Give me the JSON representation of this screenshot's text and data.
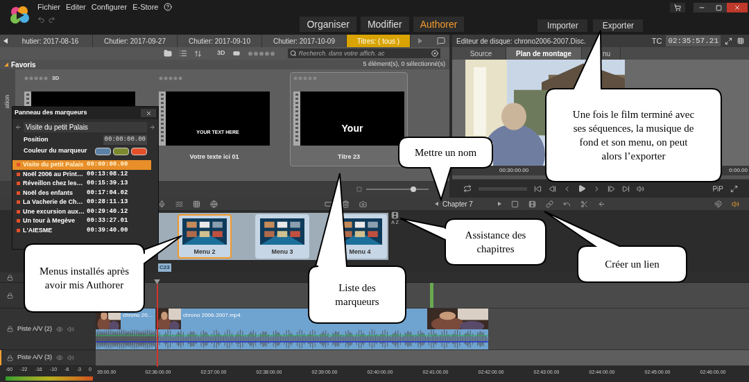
{
  "menu_bar": {
    "items": [
      "Fichier",
      "Editer",
      "Configurer",
      "E-Store"
    ]
  },
  "modes": [
    {
      "label": "Organiser",
      "selected": false
    },
    {
      "label": "Modifier",
      "selected": false
    },
    {
      "label": "Authorer",
      "selected": true
    }
  ],
  "actions": [
    "Importer",
    "Exporter"
  ],
  "library": {
    "bins": [
      {
        "label": "hutier: 2017-08-16",
        "selected": false
      },
      {
        "label": "Chutier: 2017-09-27",
        "selected": false
      },
      {
        "label": "Chutier: 2017-09-10",
        "selected": false
      },
      {
        "label": "Chutier: 2017-10-09",
        "selected": false
      },
      {
        "label": "Titres: ( tous )",
        "selected": true
      }
    ],
    "filter_3d": "3D",
    "search": {
      "placeholder": "Recherch. dans votre affich. ac"
    },
    "section": "Favoris",
    "count": "5 élément(s), 0 sélectionné(s)",
    "side_tab": "ation",
    "items": [
      {
        "tag": "3D",
        "selected": false
      },
      {
        "preview_text": "YOUR TEXT HERE",
        "caption": "Votre texte ici 01",
        "selected": false
      },
      {
        "preview_text": "Your",
        "caption": "Titre 23",
        "selected": true
      }
    ],
    "zoom": {
      "level": 0.75
    }
  },
  "marker_panel": {
    "title": "Panneau des marqueurs",
    "name": "Visite du petit Palais",
    "position_label": "Position",
    "position": "00:00:00.00",
    "color_label": "Couleur du marqueur",
    "colors": [
      {
        "color": "#5b82a6"
      },
      {
        "color": "#7d8a2e"
      },
      {
        "color": "#e4502a"
      }
    ],
    "markers": [
      {
        "name": "Visite du petit Palais",
        "time": "00:00:00.00",
        "selected": true
      },
      {
        "name": "Noël 2006 au Print…",
        "time": "00:13:08.12",
        "selected": false
      },
      {
        "name": "Réveillon chez les…",
        "time": "00:15:39.13",
        "selected": false
      },
      {
        "name": "Noël des enfants",
        "time": "00:17:04.02",
        "selected": false
      },
      {
        "name": "La Vacherie de Ch…",
        "time": "00:28:11.13",
        "selected": false
      },
      {
        "name": "Une excursion aux…",
        "time": "00:29:40.12",
        "selected": false
      },
      {
        "name": "Un tour à Megève",
        "time": "00:33:27.01",
        "selected": false
      },
      {
        "name": "L'AIESME",
        "time": "00:39:40.00",
        "selected": false
      }
    ]
  },
  "player": {
    "title": "Editeur de disque: chrono2006-2007.Disc.",
    "tc_label": "TC",
    "timecode": "02:35:57.21",
    "tabs": [
      {
        "label": "Source",
        "selected": false
      },
      {
        "label": "Plan de montage",
        "selected": true
      },
      {
        "label": "nu",
        "selected": false
      }
    ],
    "ruler": [
      "00:30:00.00",
      "0:00.00"
    ],
    "pip": "PiP"
  },
  "authoring": {
    "chapter": "Chapter 7",
    "menus": [
      {
        "label": "Menu 2",
        "selected": true
      },
      {
        "label": "Menu 3",
        "selected": false
      },
      {
        "label": "Menu 4",
        "selected": false
      }
    ],
    "sort_label": "A Z",
    "chapter_tag": "C23"
  },
  "timeline": {
    "tracks": [
      {
        "kind": "spacer",
        "selected": false
      },
      {
        "kind": "markers",
        "selected": false
      },
      {
        "kind": "av",
        "name": "Piste A/V (2)",
        "clips": [
          "chrono 20…",
          "chrono 2006-2007.mp4"
        ],
        "selected": false
      },
      {
        "kind": "av",
        "name": "Piste A/V (3)",
        "selected": true
      }
    ],
    "meter_scale": [
      "-60",
      "-22",
      "-16",
      "-10",
      "-6",
      "-3",
      "0"
    ],
    "ruler": [
      "35:00.00",
      "02:36:00.00",
      "02:37:00.00",
      "02:38:00.00",
      "02:39:00.00",
      "02:40:00.00",
      "02:41:00.00",
      "02:42:00.00",
      "02:43:00.00",
      "02:44:00.00",
      "02:45:00.00",
      "02:46:00.00"
    ]
  },
  "callouts": [
    "Mettre un nom",
    "Une fois le film terminé avec ses séquences, la musique de fond et son menu, on peut alors l’exporter",
    "Menus installés après avoir mis Authorer",
    "Liste des marqueurs",
    "Assistance des chapitres",
    "Créer un lien"
  ]
}
